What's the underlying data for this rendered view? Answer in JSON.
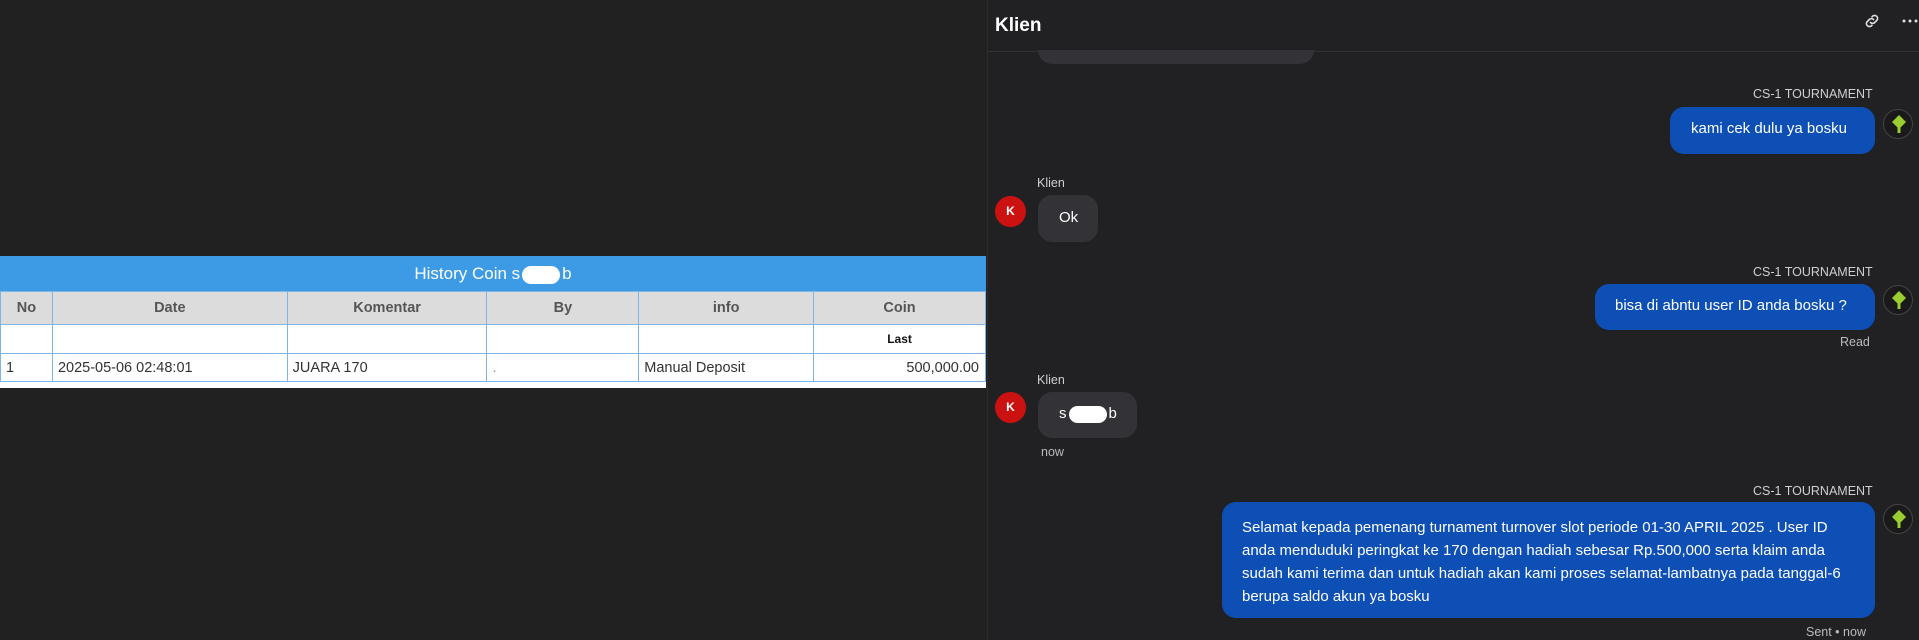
{
  "history": {
    "title_prefix": "History Coin s",
    "title_suffix": "b",
    "columns": [
      "No",
      "Date",
      "Komentar",
      "By",
      "info",
      "Coin"
    ],
    "sub_header": "Last",
    "rows": [
      {
        "no": "1",
        "date": "2025-05-06 02:48:01",
        "komentar": "JUARA 170",
        "by": ".",
        "info": "Manual Deposit",
        "coin": "500,000.00"
      }
    ]
  },
  "chat": {
    "title": "Klien",
    "header_icons": [
      "link-icon",
      "more-icon"
    ],
    "messages": [
      {
        "sender": "CS-1 TOURNAMENT",
        "text": "kami cek dulu ya bosku",
        "direction": "out"
      },
      {
        "sender": "Klien",
        "text": "Ok",
        "direction": "in",
        "avatar": "K"
      },
      {
        "sender": "CS-1 TOURNAMENT",
        "text": "bisa di abntu user ID anda bosku ?",
        "direction": "out",
        "status": "Read"
      },
      {
        "sender": "Klien",
        "text_prefix": "s",
        "text_suffix": "b",
        "direction": "in",
        "avatar": "K",
        "time": "now"
      },
      {
        "sender": "CS-1 TOURNAMENT",
        "text": "Selamat kepada pemenang turnament turnover slot periode 01-30 APRIL 2025 . User ID anda menduduki peringkat ke 170 dengan hadiah sebesar Rp.500,000 serta klaim anda sudah kami terima dan untuk hadiah akan kami proses selamat-lambatnya pada tanggal-6 berupa saldo akun ya bosku",
        "direction": "out",
        "status": "Sent • now"
      }
    ]
  },
  "colors": {
    "outgoing_bubble": "#0d4fb5",
    "incoming_bubble": "#333337",
    "avatar_klien": "#cc1111",
    "table_header": "#3d9be6",
    "coin_value": "#2e8b2e"
  }
}
